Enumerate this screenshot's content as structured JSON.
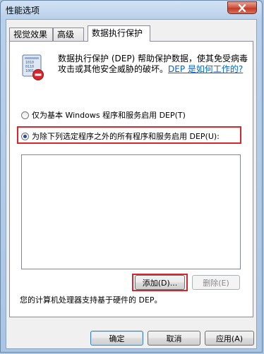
{
  "window": {
    "title": "性能选项"
  },
  "tabs": [
    {
      "label": "视觉效果"
    },
    {
      "label": "高级"
    },
    {
      "label": "数据执行保护"
    }
  ],
  "dep": {
    "description": "数据执行保护 (DEP) 帮助保护数据，使其免受病毒攻击或其他安全威胁的破坏。",
    "link": "DEP 是如何工作的?",
    "option_essential": "仅为基本 Windows 程序和服务启用 DEP(T)",
    "option_all_except": "为除下列选定程序之外的所有程序和服务启用 DEP(U):",
    "selected_option": "option_all_except",
    "add_button": "添加(D)...",
    "remove_button": "删除(E)",
    "status": "您的计算机处理器支持基于硬件的 DEP。"
  },
  "footer": {
    "ok": "确定",
    "cancel": "取消",
    "apply": "应用(A)"
  },
  "icons": {
    "close": "close-icon",
    "dep": "dep-shield-icon"
  },
  "colors": {
    "highlight": "#d9262c",
    "link": "#0066cc",
    "close_button": "#c23d28"
  }
}
